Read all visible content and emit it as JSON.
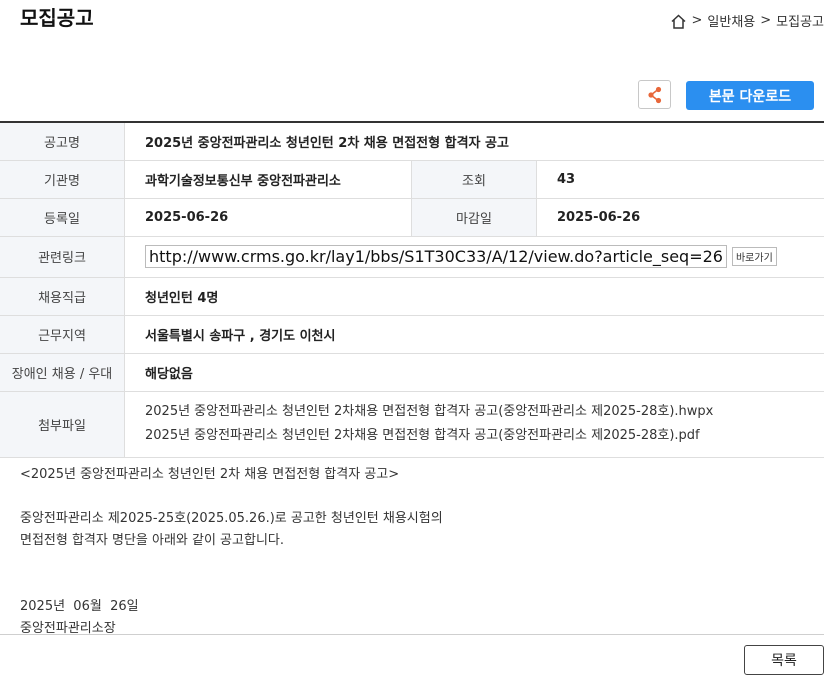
{
  "header": {
    "title": "모집공고"
  },
  "breadcrumb": {
    "items": [
      "일반채용",
      "모집공고"
    ]
  },
  "toolbar": {
    "download_label": "본문 다운로드"
  },
  "info": {
    "title_label": "공고명",
    "title_value": "2025년 중앙전파관리소 청년인턴 2차 채용 면접전형 합격자 공고",
    "org_label": "기관명",
    "org_value": "과학기술정보통신부 중앙전파관리소",
    "views_label": "조회",
    "views_value": "43",
    "reg_label": "등록일",
    "reg_value": "2025-06-26",
    "deadline_label": "마감일",
    "deadline_value": "2025-06-26",
    "link_label": "관련링크",
    "link_value": "http://www.crms.go.kr/lay1/bbs/S1T30C33/A/12/view.do?article_seq=26",
    "goto_label": "바로가기",
    "job_label": "채용직급",
    "job_value": "청년인턴 4명",
    "region_label": "근무지역",
    "region_value": "서울특별시 송파구 , 경기도 이천시",
    "disabled_label": "장애인 채용 / 우대",
    "disabled_value": "해당없음",
    "files_label": "첨부파일",
    "files": [
      "2025년 중앙전파관리소 청년인턴 2차채용 면접전형 합격자 공고(중앙전파관리소 제2025-28호).hwpx",
      "2025년 중앙전파관리소 청년인턴 2차채용 면접전형 합격자 공고(중앙전파관리소 제2025-28호).pdf"
    ]
  },
  "body": {
    "heading": "<2025년 중앙전파관리소 청년인턴 2차 채용 면접전형 합격자 공고>",
    "line1": "중앙전파관리소 제2025-25호(2025.05.26.)로 공고한 청년인턴 채용시험의",
    "line2": "면접전형 합격자 명단을 아래와 같이 공고합니다.",
    "date": "2025년  06월  26일",
    "signer": "중앙전파관리소장"
  },
  "footer": {
    "list_label": "목록"
  },
  "colors": {
    "accent": "#2b8ff0",
    "share_icon": "#e8673a"
  },
  "icons": {
    "home": "home-icon",
    "share": "share-icon"
  }
}
